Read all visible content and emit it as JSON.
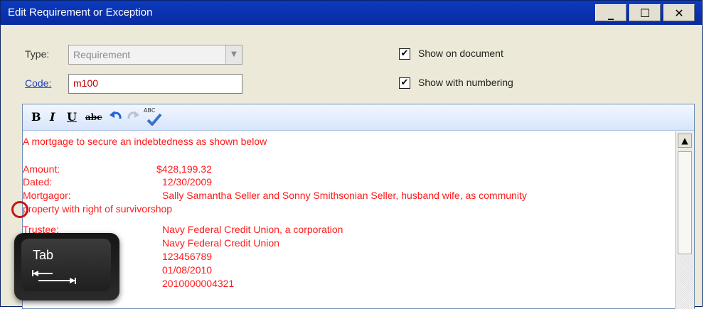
{
  "window": {
    "title": "Edit Requirement or Exception"
  },
  "form": {
    "type_label": "Type:",
    "type_value": "Requirement",
    "code_label": "Code:",
    "code_value": "m100",
    "show_on_document": {
      "label": "Show on document",
      "checked": true
    },
    "show_with_numbering": {
      "label": "Show with numbering",
      "checked": true
    }
  },
  "toolbar": {
    "bold": "B",
    "italic": "I",
    "underline": "U",
    "strike": "abc",
    "spell": "ABC"
  },
  "editor": {
    "intro": "A mortgage to secure an indebtedness as shown below",
    "amount_label": "Amount:",
    "amount_value": "$428,199.32",
    "dated_label": "Dated:",
    "dated_value": "12/30/2009",
    "mortgagor_label": "Mortgagor:",
    "mortgagor_value": "Sally Samantha Seller and Sonny Smithsonian Seller, husband wife, as community",
    "continuation": "property with right of survivorshop",
    "trustee_label": "Trustee:",
    "trustee_value": "Navy Federal Credit Union, a corporation",
    "value_2": "Navy Federal Credit Union",
    "value_3": "123456789",
    "value_4": "01/08/2010",
    "value_5": "2010000004321"
  },
  "tab_key": {
    "label": "Tab"
  }
}
